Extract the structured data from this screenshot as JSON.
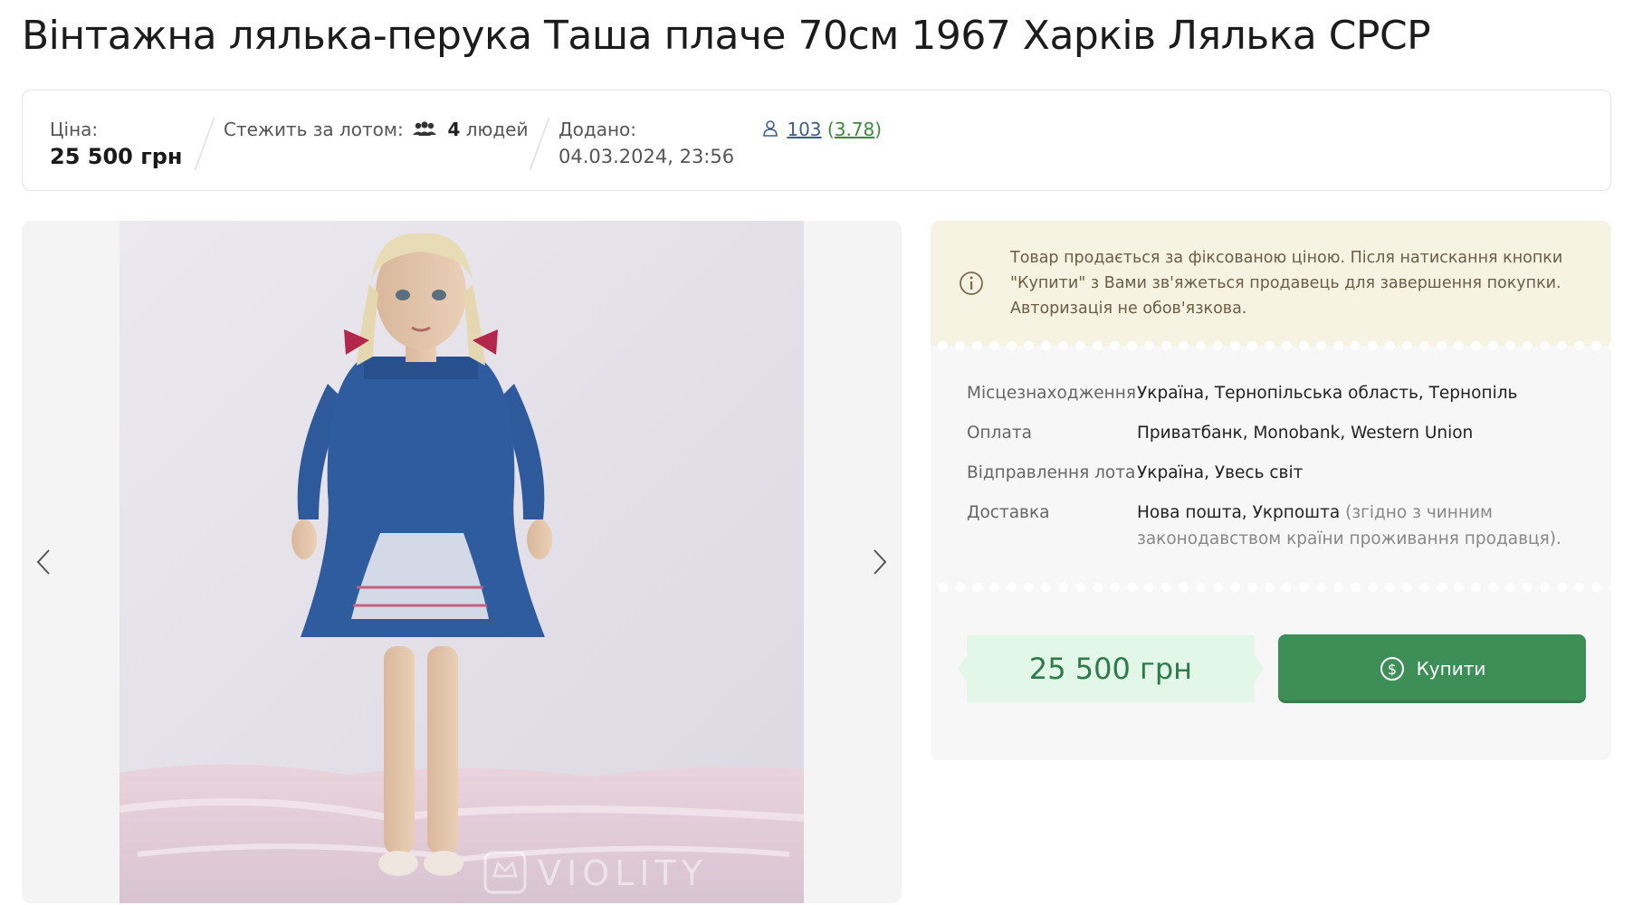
{
  "title": "Вінтажна лялька-перука Таша плаче 70см 1967 Харків Лялька СРСР",
  "info": {
    "price_label": "Ціна:",
    "price_value": "25 500 грн",
    "watch_label": "Стежить за лотом:",
    "watch_count": "4",
    "watch_unit": "людей",
    "added_label": "Додано:",
    "added_value": "04.03.2024, 23:56",
    "seller_reviews": "103",
    "seller_rating": "3.78"
  },
  "gallery": {
    "watermark": "VIOLITY"
  },
  "notice": {
    "text": "Товар продається за фіксованою ціною. Після натискання кнопки \"Купити\" з Вами зв'яжеться продавець для завершення покупки. Авторизація не обов'язкова."
  },
  "details": [
    {
      "label": "Місцезнаходження",
      "value": "Україна, Тернопільська область, Тернопіль",
      "note": ""
    },
    {
      "label": "Оплата",
      "value": "Приватбанк, Monobank, Western Union",
      "note": ""
    },
    {
      "label": "Відправлення лота",
      "value": "Україна, Увесь світ",
      "note": ""
    },
    {
      "label": "Доставка",
      "value": "Нова пошта, Укрпошта",
      "note": " (згідно з чинним законодавством країни проживання продавця)."
    }
  ],
  "purchase": {
    "price": "25 500 грн",
    "buy_label": "Купити"
  },
  "colors": {
    "accent_green": "#3e8f57",
    "price_bg": "#e2f7e8",
    "notice_bg": "#f7f3e3"
  }
}
